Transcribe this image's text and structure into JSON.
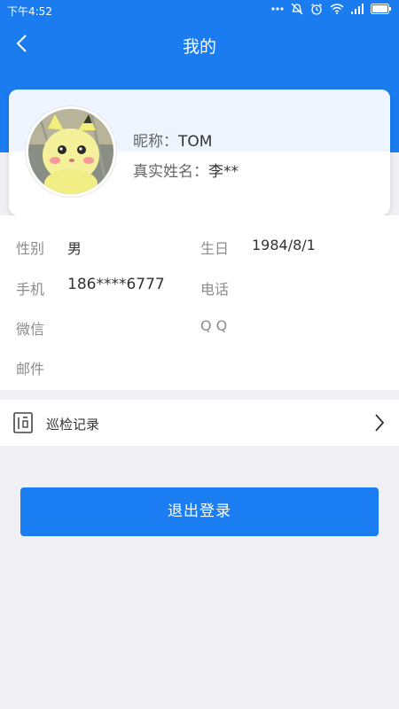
{
  "status_bar": {
    "time": "下午4:52",
    "battery_color": "#ffffff"
  },
  "nav": {
    "title": "我的",
    "back_icon": "chevron-left-icon"
  },
  "profile": {
    "nickname_label": "昵称：",
    "nickname": "TOM",
    "realname_label": "真实姓名：",
    "realname": "李**"
  },
  "info": {
    "gender_label": "性别",
    "gender": "男",
    "birthday_label": "生日",
    "birthday": "1984/8/1",
    "mobile_label": "手机",
    "mobile": "186****6777",
    "phone_label": "电话",
    "phone": "",
    "wechat_label": "微信",
    "wechat": "",
    "qq_label": "Q Q",
    "qq": "",
    "email_label": "邮件",
    "email": ""
  },
  "menu": {
    "inspection_label": "巡检记录",
    "inspection_icon": "document-icon"
  },
  "logout": {
    "label": "退出登录"
  },
  "colors": {
    "primary": "#1b7cf0",
    "background": "#efeff4"
  }
}
